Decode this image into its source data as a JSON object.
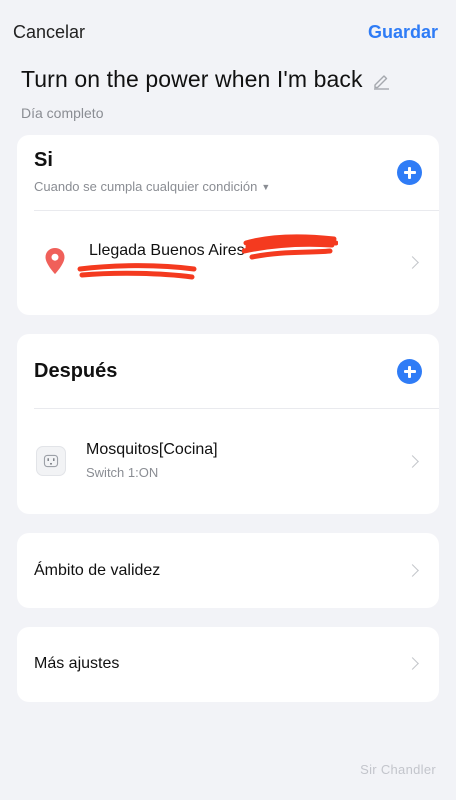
{
  "header": {
    "cancel_label": "Cancelar",
    "save_label": "Guardar"
  },
  "scene": {
    "title": "Turn on the power when I'm back",
    "schedule": "Día completo"
  },
  "if_section": {
    "title": "Si",
    "condition_mode": "Cuando se cumpla cualquier condición",
    "conditions": [
      {
        "title": "Llegada Buenos Aires",
        "icon": "location-pin-icon",
        "redacted": true
      }
    ]
  },
  "then_section": {
    "title": "Después",
    "actions": [
      {
        "title": "Mosquitos[Cocina]",
        "detail": "Switch 1:ON",
        "icon": "smart-plug-icon"
      }
    ]
  },
  "settings": {
    "validity_label": "Ámbito de validez",
    "more_settings_label": "Más ajustes"
  },
  "watermark": "Sir Chandler",
  "colors": {
    "accent": "#2f7cf6",
    "background": "#f2f3f7",
    "location_pin": "#f0605a",
    "redaction": "#f43a1f"
  }
}
